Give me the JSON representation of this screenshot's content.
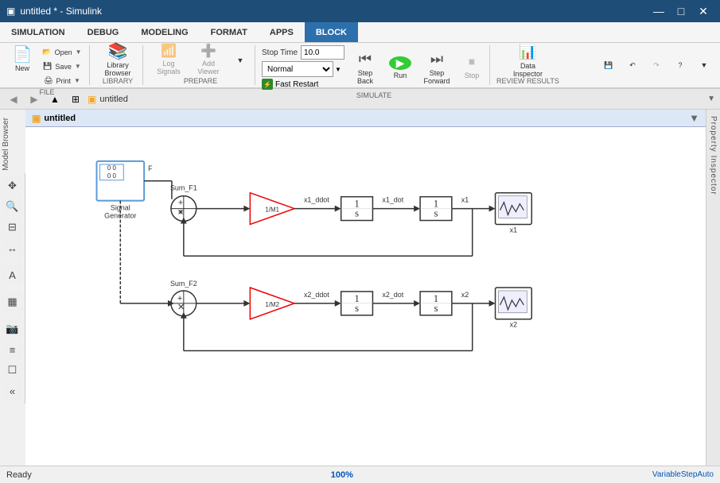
{
  "titleBar": {
    "title": "untitled * - Simulink",
    "icon": "▣"
  },
  "titleControls": {
    "minimize": "—",
    "maximize": "□",
    "close": "✕"
  },
  "menuBar": {
    "items": [
      {
        "id": "simulation",
        "label": "SIMULATION",
        "active": false
      },
      {
        "id": "debug",
        "label": "DEBUG",
        "active": false
      },
      {
        "id": "modeling",
        "label": "MODELING",
        "active": false
      },
      {
        "id": "format",
        "label": "FORMAT",
        "active": false
      },
      {
        "id": "apps",
        "label": "APPS",
        "active": false
      },
      {
        "id": "block",
        "label": "BLOCK",
        "active": true
      }
    ]
  },
  "toolbar": {
    "file": {
      "new_label": "New",
      "open_label": "Open",
      "save_label": "Save",
      "print_label": "Print",
      "section_label": "FILE"
    },
    "library": {
      "browser_label": "Library\nBrowser",
      "section_label": "LIBRARY"
    },
    "prepare": {
      "log_signals_label": "Log\nSignals",
      "add_viewer_label": "Add\nViewer",
      "section_label": "PREPARE"
    },
    "simulate": {
      "stop_time_label": "Stop Time",
      "stop_time_value": "10.0",
      "mode_label": "Normal",
      "fast_restart_label": "Fast Restart",
      "step_back_label": "Step\nBack",
      "run_label": "Run",
      "step_forward_label": "Step\nForward",
      "stop_label": "Stop",
      "section_label": "SIMULATE"
    },
    "review": {
      "data_inspector_label": "Data\nInspector",
      "section_label": "REVIEW RESULTS"
    }
  },
  "addressBar": {
    "back_label": "◀",
    "forward_label": "▶",
    "up_label": "▲",
    "fit_label": "⊡",
    "breadcrumb": "untitled",
    "section_icon": "▣"
  },
  "leftToolbar": {
    "buttons": [
      {
        "id": "hand",
        "icon": "✥",
        "label": "hand"
      },
      {
        "id": "zoom-in",
        "icon": "🔍",
        "label": "zoom-in"
      },
      {
        "id": "zoom-fit",
        "icon": "⊡",
        "label": "zoom-fit"
      },
      {
        "id": "arrow",
        "icon": "↔",
        "label": "arrow"
      },
      {
        "id": "text",
        "icon": "A",
        "label": "text"
      },
      {
        "id": "image",
        "icon": "▦",
        "label": "image"
      },
      {
        "id": "camera",
        "icon": "📷",
        "label": "camera"
      },
      {
        "id": "book",
        "icon": "📋",
        "label": "book"
      },
      {
        "id": "collapse",
        "icon": "«",
        "label": "collapse"
      }
    ]
  },
  "diagram": {
    "title": "untitled",
    "blocks": {
      "signal_generator": {
        "label": "Signal\nGenerator",
        "sublabel": "F"
      },
      "sum_f1": {
        "label": "Sum_F1"
      },
      "gain_m1": {
        "label": "1/M1"
      },
      "integrator1_top": {
        "label": "1/s"
      },
      "integrator2_top": {
        "label": "1/s"
      },
      "scope_x1": {
        "label": "x1"
      },
      "x1ddot_label": "x1_ddot",
      "x1dot_label": "x1_dot",
      "x1_label": "x1",
      "sum_f2": {
        "label": "Sum_F2"
      },
      "gain_m2": {
        "label": "1/M2"
      },
      "integrator1_bot": {
        "label": "1/s"
      },
      "integrator2_bot": {
        "label": "1/s"
      },
      "scope_x2": {
        "label": "x2"
      },
      "x2ddot_label": "x2_ddot",
      "x2dot_label": "x2_dot",
      "x2_label": "x2"
    }
  },
  "rightSidebar": {
    "property_inspector_label": "Property Inspector"
  },
  "statusBar": {
    "ready_label": "Ready",
    "zoom_label": "100%",
    "solver_label": "VariableStepAuto",
    "url": "https://blog.csdn..."
  }
}
